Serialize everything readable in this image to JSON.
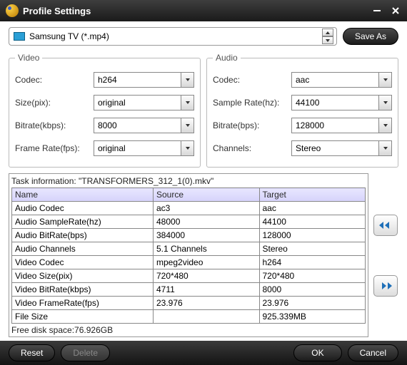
{
  "window": {
    "title": "Profile Settings"
  },
  "profile": {
    "selected": "Samsung TV (*.mp4)",
    "save_as": "Save As"
  },
  "video": {
    "legend": "Video",
    "codec_label": "Codec:",
    "codec_value": "h264",
    "size_label": "Size(pix):",
    "size_value": "original",
    "bitrate_label": "Bitrate(kbps):",
    "bitrate_value": "8000",
    "framerate_label": "Frame Rate(fps):",
    "framerate_value": "original"
  },
  "audio": {
    "legend": "Audio",
    "codec_label": "Codec:",
    "codec_value": "aac",
    "samplerate_label": "Sample Rate(hz):",
    "samplerate_value": "44100",
    "bitrate_label": "Bitrate(bps):",
    "bitrate_value": "128000",
    "channels_label": "Channels:",
    "channels_value": "Stereo"
  },
  "task": {
    "label": "Task information: \"TRANSFORMERS_312_1(0).mkv\"",
    "headers": {
      "name": "Name",
      "source": "Source",
      "target": "Target"
    },
    "rows": [
      {
        "name": "Audio Codec",
        "source": "ac3",
        "target": "aac"
      },
      {
        "name": "Audio SampleRate(hz)",
        "source": "48000",
        "target": "44100"
      },
      {
        "name": "Audio BitRate(bps)",
        "source": "384000",
        "target": "128000"
      },
      {
        "name": "Audio Channels",
        "source": "5.1 Channels",
        "target": "Stereo"
      },
      {
        "name": "Video Codec",
        "source": "mpeg2video",
        "target": "h264"
      },
      {
        "name": "Video Size(pix)",
        "source": "720*480",
        "target": "720*480"
      },
      {
        "name": "Video BitRate(kbps)",
        "source": "4711",
        "target": "8000"
      },
      {
        "name": "Video FrameRate(fps)",
        "source": "23.976",
        "target": "23.976"
      },
      {
        "name": "File Size",
        "source": "",
        "target": "925.339MB"
      }
    ],
    "free_space": "Free disk space:76.926GB"
  },
  "footer": {
    "reset": "Reset",
    "delete": "Delete",
    "ok": "OK",
    "cancel": "Cancel"
  }
}
